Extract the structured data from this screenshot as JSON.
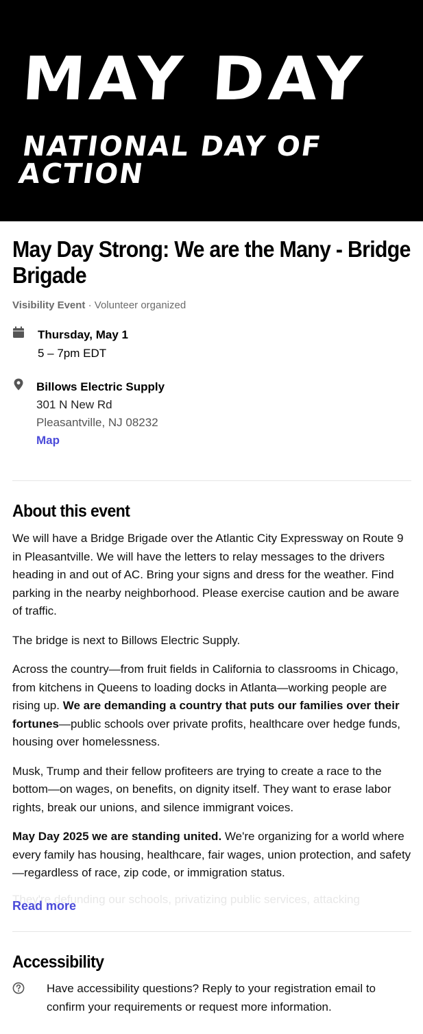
{
  "banner": {
    "title": "MAY DAY",
    "subtitle": "NATIONAL DAY OF ACTION"
  },
  "event": {
    "title": "May Day Strong: We are the Many - Bridge Brigade",
    "type": "Visibility Event",
    "organized": " · Volunteer organized"
  },
  "when": {
    "date": "Thursday, May 1",
    "time": "5 – 7pm EDT",
    "icon": "calendar-icon"
  },
  "where": {
    "name": "Billows Electric Supply",
    "address": "301 N New Rd",
    "city": "Pleasantville, NJ 08232",
    "map_label": "Map",
    "icon": "location-pin-icon"
  },
  "about": {
    "heading": "About this event",
    "p1": "We will have a Bridge Brigade over the Atlantic City Expressway on Route 9 in Pleasantville. We will have the letters to relay messages to the drivers heading in and out of AC. Bring your signs and dress for the weather. Find parking in the nearby neighborhood. Please exercise caution and be aware of traffic.",
    "p2": "The bridge is next to Billows Electric Supply.",
    "p3_a": "Across the country—from fruit fields in California to classrooms in Chicago, from kitchens in Queens to loading docks in Atlanta—working people are rising up. ",
    "p3_bold": "We are demanding a country that puts our families over their fortunes",
    "p3_b": "—public schools over private profits, healthcare over hedge funds, housing over homelessness.",
    "p4": "Musk, Trump and their fellow profiteers are trying to create a race to the bottom—on wages, on benefits, on dignity itself. They want to erase labor rights, break our unions, and silence immigrant voices.",
    "p5_bold": "May Day 2025 we are standing united.",
    "p5_rest": " We're organizing for a world where every family has housing, healthcare, fair wages, union protection, and safety—regardless of race, zip code, or immigration status.",
    "p6_faded": "They're defunding our schools, privatizing public services, attacking",
    "read_more": "Read more"
  },
  "accessibility": {
    "heading": "Accessibility",
    "text": "Have accessibility questions? Reply to your registration email to confirm your requirements or request more information.",
    "icon": "question-circle-icon"
  },
  "colors": {
    "link": "#4b4bd9",
    "banner_bg": "#000000",
    "muted": "#6b6b6b"
  }
}
